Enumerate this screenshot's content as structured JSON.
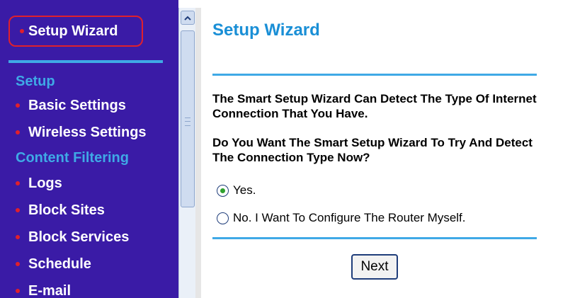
{
  "sidebar": {
    "setup_wizard": "Setup Wizard",
    "sections": [
      {
        "header": "Setup",
        "items": [
          "Basic Settings",
          "Wireless Settings"
        ]
      },
      {
        "header": "Content Filtering",
        "items": [
          "Logs",
          "Block Sites",
          "Block Services",
          "Schedule",
          "E-mail"
        ]
      }
    ]
  },
  "main": {
    "title": "Setup Wizard",
    "paragraph1": "The Smart Setup Wizard Can Detect The Type Of Internet Connection That You Have.",
    "paragraph2": "Do You Want The Smart Setup Wizard To Try And Detect The Connection Type Now?",
    "options": [
      {
        "label": "Yes.",
        "selected": true
      },
      {
        "label": "No. I Want To Configure The Router Myself.",
        "selected": false
      }
    ],
    "next_label": "Next"
  },
  "colors": {
    "sidebar_bg": "#3a1ba6",
    "accent_blue": "#3fa9e6",
    "bullet_red": "#e0202c",
    "title_blue": "#1a8fd6"
  },
  "icons": {
    "scroll_up": "chevron-up-icon",
    "bullet": "dot-icon"
  }
}
